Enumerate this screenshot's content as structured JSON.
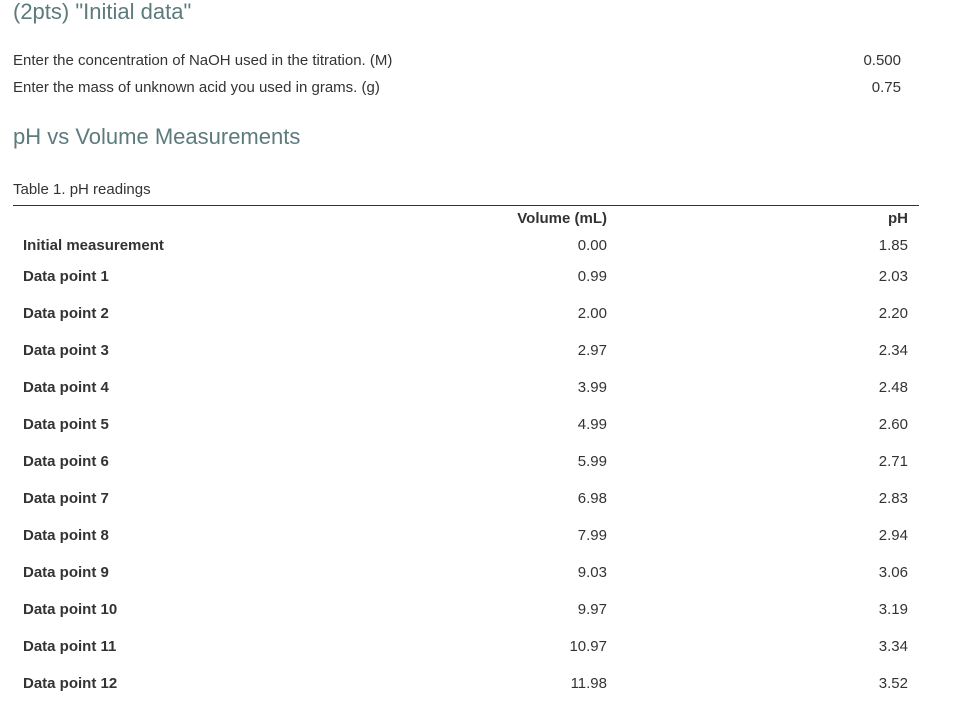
{
  "initial_data": {
    "title": "(2pts) \"Initial data\"",
    "fields": [
      {
        "label": "Enter the concentration of NaOH used in the titration. (M)",
        "value": "0.500"
      },
      {
        "label": "Enter the mass of unknown acid you used in grams. (g)",
        "value": "0.75"
      }
    ]
  },
  "ph_section": {
    "title": "pH vs Volume Measurements",
    "table_caption": "Table 1. pH readings",
    "columns": [
      "Volume (mL)",
      "pH"
    ],
    "rows": [
      {
        "label": "Initial measurement",
        "volume": "0.00",
        "ph": "1.85"
      },
      {
        "label": "Data point 1",
        "volume": "0.99",
        "ph": "2.03"
      },
      {
        "label": "Data point 2",
        "volume": "2.00",
        "ph": "2.20"
      },
      {
        "label": "Data point 3",
        "volume": "2.97",
        "ph": "2.34"
      },
      {
        "label": "Data point 4",
        "volume": "3.99",
        "ph": "2.48"
      },
      {
        "label": "Data point 5",
        "volume": "4.99",
        "ph": "2.60"
      },
      {
        "label": "Data point 6",
        "volume": "5.99",
        "ph": "2.71"
      },
      {
        "label": "Data point 7",
        "volume": "6.98",
        "ph": "2.83"
      },
      {
        "label": "Data point 8",
        "volume": "7.99",
        "ph": "2.94"
      },
      {
        "label": "Data point 9",
        "volume": "9.03",
        "ph": "3.06"
      },
      {
        "label": "Data point 10",
        "volume": "9.97",
        "ph": "3.19"
      },
      {
        "label": "Data point 11",
        "volume": "10.97",
        "ph": "3.34"
      },
      {
        "label": "Data point 12",
        "volume": "11.98",
        "ph": "3.52"
      }
    ]
  },
  "colors": {
    "section_title": "#5d7a7d",
    "text": "#333333",
    "rule": "#333333"
  }
}
